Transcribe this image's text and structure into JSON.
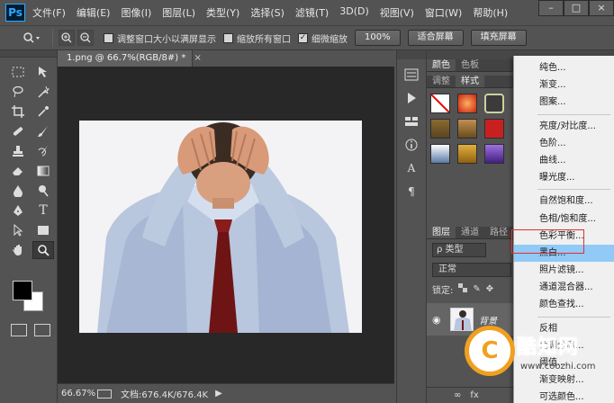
{
  "app": {
    "logo": "Ps"
  },
  "menubar": {
    "items": [
      "文件(F)",
      "编辑(E)",
      "图像(I)",
      "图层(L)",
      "类型(Y)",
      "选择(S)",
      "滤镜(T)",
      "3D(D)",
      "视图(V)",
      "窗口(W)",
      "帮助(H)"
    ],
    "window_controls": [
      "–",
      "□",
      "×"
    ]
  },
  "options_bar": {
    "checkbox_resize": "调整窗口大小以满屏显示",
    "checkbox_zoom_all": "缩放所有窗口",
    "checkbox_scrubby": "细微缩放",
    "scrubby_checked": true,
    "btn_100": "100%",
    "btn_fit": "适合屏幕",
    "btn_fill": "填充屏幕"
  },
  "document": {
    "tab_title": "1.png @ 66.7%(RGB/8#) *",
    "tab_close": "×"
  },
  "status_bar": {
    "zoom": "66.67%",
    "doc_info": "文档:676.4K/676.4K",
    "arrow": "▶"
  },
  "right_panels": {
    "top_tabs": [
      "颜色",
      "色板"
    ],
    "sub_tabs": [
      "调整",
      "样式"
    ],
    "layer_tabs": [
      "图层",
      "通道",
      "路径"
    ],
    "layer_filter": "ρ 类型",
    "blend_mode": "正常",
    "lock_label": "锁定:",
    "layer_name": "背景",
    "layer_bottom_icons": [
      "∞",
      "fx"
    ]
  },
  "adjustment_menu": {
    "groups": [
      [
        "纯色...",
        "渐变...",
        "图案..."
      ],
      [
        "亮度/对比度...",
        "色阶...",
        "曲线...",
        "曝光度..."
      ],
      [
        "自然饱和度...",
        "色相/饱和度...",
        "色彩平衡...",
        "黑白...",
        "照片滤镜...",
        "通道混合器...",
        "颜色查找..."
      ],
      [
        "反相",
        "色调分离...",
        "阈值...",
        "渐变映射...",
        "可选颜色..."
      ]
    ],
    "highlighted": "黑白..."
  },
  "watermark": {
    "logo_letter": "C",
    "title": "酷知网",
    "url": "www.coozhi.com"
  },
  "colors": {
    "foreground": "#000000",
    "background": "#ffffff",
    "menu_highlight": "#91c9f7",
    "annotation_red": "#e23030"
  }
}
